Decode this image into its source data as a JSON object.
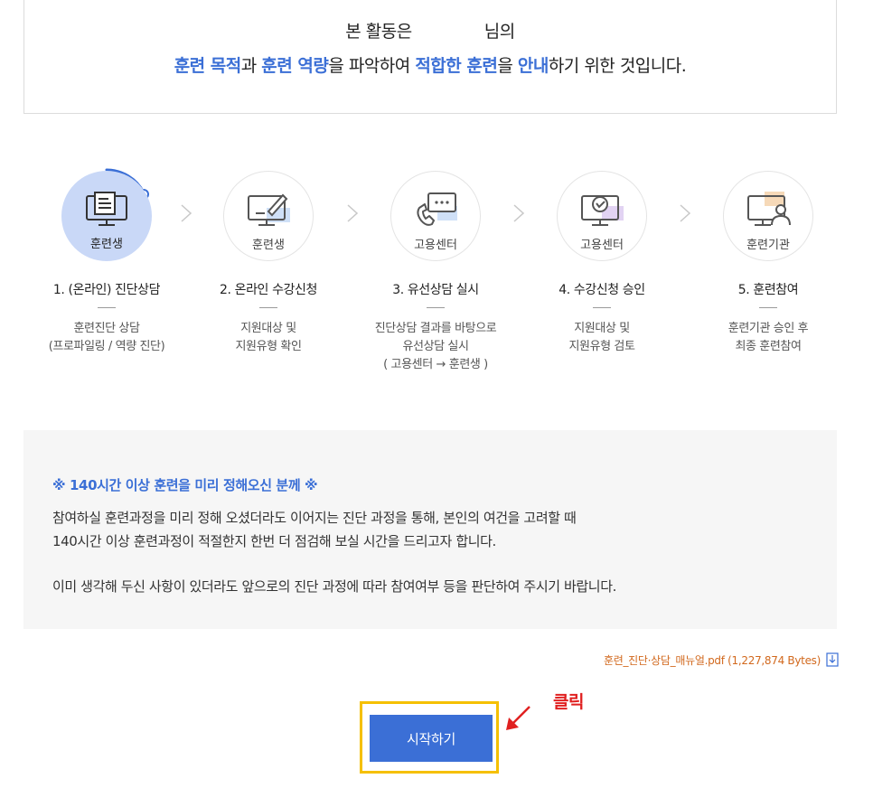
{
  "intro": {
    "line1_before": "본 활동은",
    "line1_after": "님의",
    "line2_parts": [
      {
        "text": "훈련 목적",
        "hl": true
      },
      {
        "text": "과 ",
        "hl": false
      },
      {
        "text": "훈련 역량",
        "hl": true
      },
      {
        "text": "을 파악하여 ",
        "hl": false
      },
      {
        "text": "적합한 훈련",
        "hl": true
      },
      {
        "text": "을 ",
        "hl": false
      },
      {
        "text": "안내",
        "hl": true
      },
      {
        "text": "하기 위한 것입니다.",
        "hl": false
      }
    ]
  },
  "steps": [
    {
      "circle_label": "훈련생",
      "icon": "monitor-document-icon",
      "title": "1. (온라인) 진단상담",
      "desc": [
        "훈련진단 상담",
        "(프로파일링 / 역량 진단)"
      ],
      "active": true
    },
    {
      "circle_label": "훈련생",
      "icon": "monitor-pen-icon",
      "title": "2. 온라인 수강신청",
      "desc": [
        "지원대상 및",
        "지원유형 확인"
      ],
      "active": false
    },
    {
      "circle_label": "고용센터",
      "icon": "phone-chat-icon",
      "title": "3. 유선상담 실시",
      "desc": [
        "진단상담 결과를 바탕으로",
        "유선상담 실시",
        "( 고용센터 → 훈련생 )"
      ],
      "active": false
    },
    {
      "circle_label": "고용센터",
      "icon": "monitor-check-icon",
      "title": "4. 수강신청 승인",
      "desc": [
        "지원대상 및",
        "지원유형 검토"
      ],
      "active": false
    },
    {
      "circle_label": "훈련기관",
      "icon": "monitor-person-icon",
      "title": "5. 훈련참여",
      "desc": [
        "훈련기관 승인 후",
        "최종 훈련참여"
      ],
      "active": false
    }
  ],
  "notice": {
    "title": "※ 140시간 이상 훈련을 미리 정해오신 분께 ※",
    "lines": [
      "참여하실 훈련과정을 미리 정해 오셨더라도 이어지는 진단 과정을 통해, 본인의 여건을 고려할 때",
      "140시간 이상 훈련과정이 적절한지 한번 더 점검해 보실 시간을 드리고자 합니다.",
      "이미 생각해 두신 사항이 있더라도 앞으로의 진단 과정에 따라 참여여부 등을 판단하여 주시기 바랍니다."
    ]
  },
  "download": {
    "text": "훈련_진단·상담_매뉴얼.pdf (1,227,874 Bytes)",
    "icon": "download-icon"
  },
  "annotation": {
    "click_label": "클릭",
    "arrow_color": "#e02020",
    "frame_color": "#f5c000"
  },
  "start_button": {
    "label": "시작하기"
  },
  "colors": {
    "accent": "#3b6fd6",
    "active_circle": "#c9d8f7",
    "download_text": "#d2691e"
  }
}
